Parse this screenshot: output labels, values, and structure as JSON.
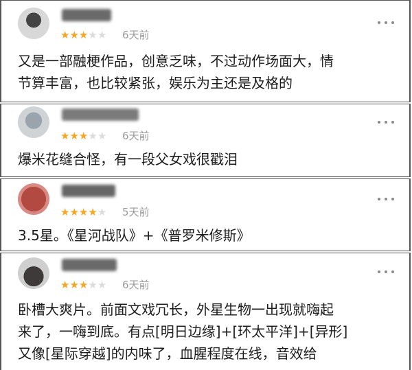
{
  "colors": {
    "star_on": "#f5a623",
    "star_off": "#dcdcdc",
    "time": "#9a9a9a"
  },
  "reviews": [
    {
      "user": "",
      "rating": 3,
      "max_rating": 5,
      "time": "6天前",
      "content_lines": [
        "又是一部融梗作品，创意乏味，不过动作场面大，情",
        "节算丰富，也比较紧张，娱乐为主还是及格的"
      ],
      "more_icon": "more-dots-icon"
    },
    {
      "user": "",
      "rating": 3,
      "max_rating": 5,
      "time": "6天前",
      "content_lines": [
        "爆米花缝合怪，有一段父女戏很戳泪"
      ],
      "more_icon": "more-dots-icon"
    },
    {
      "user": "",
      "rating": 4,
      "max_rating": 5,
      "time": "5天前",
      "content_lines": [
        "3.5星。《星河战队》+《普罗米修斯》"
      ],
      "more_icon": "more-dots-icon"
    },
    {
      "user": "",
      "rating": 3,
      "max_rating": 5,
      "time": "6天前",
      "content_lines": [
        "卧槽大爽片。前面文戏冗长，外星生物一出现就嗨起",
        "来了，一嗨到底。有点[明日边缘]+[环太平洋]+[异形]",
        "又像[星际穿越]的内味了，血腥程度在线，音效给"
      ],
      "more_icon": "more-dots-icon"
    }
  ]
}
